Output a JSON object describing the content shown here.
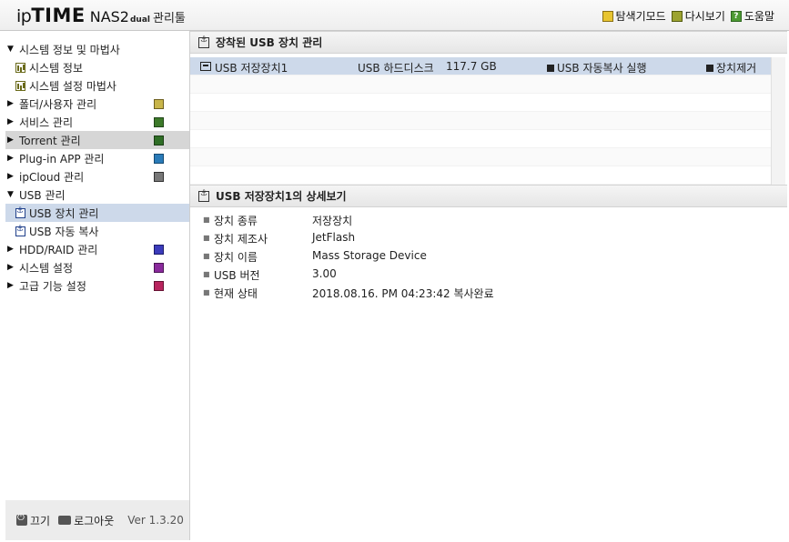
{
  "header": {
    "logo_ip": "ip",
    "logo_time": "TIME",
    "logo_model": "NAS2",
    "logo_suffix": "dual",
    "logo_tool": "관리툴",
    "links": [
      {
        "label": "탐색기모드",
        "icon": "explorer-mode-icon"
      },
      {
        "label": "다시보기",
        "icon": "refresh-icon"
      },
      {
        "label": "도움말",
        "icon": "help-icon"
      }
    ]
  },
  "sidebar": {
    "items": [
      {
        "label": "시스템 정보 및 마법사",
        "arrow": "▼"
      },
      {
        "label": "시스템 정보"
      },
      {
        "label": "시스템 설정 마법사"
      },
      {
        "label": "폴더/사용자 관리",
        "arrow": "▶"
      },
      {
        "label": "서비스 관리",
        "arrow": "▶"
      },
      {
        "label": "Torrent 관리",
        "arrow": "▶"
      },
      {
        "label": "Plug-in APP 관리",
        "arrow": "▶"
      },
      {
        "label": "ipCloud 관리",
        "arrow": "▶"
      },
      {
        "label": "USB 관리",
        "arrow": "▼"
      },
      {
        "label": "USB 장치 관리"
      },
      {
        "label": "USB 자동 복사"
      },
      {
        "label": "HDD/RAID 관리",
        "arrow": "▶"
      },
      {
        "label": "시스템 설정",
        "arrow": "▶"
      },
      {
        "label": "고급 기능 설정",
        "arrow": "▶"
      }
    ],
    "footer": {
      "power_label": "끄기",
      "logout_label": "로그아웃",
      "version": "Ver 1.3.20"
    }
  },
  "devices_panel": {
    "title": "장착된 USB 장치 관리",
    "rows": [
      {
        "name": "USB 저장장치1",
        "type": "USB 하드디스크",
        "size": "117.7 GB",
        "autocopy_label": "USB 자동복사 실행",
        "remove_label": "장치제거"
      }
    ]
  },
  "detail_panel": {
    "title": "USB 저장장치1의 상세보기",
    "fields": [
      {
        "label": "장치 종류",
        "value": "저장장치"
      },
      {
        "label": "장치 제조사",
        "value": "JetFlash"
      },
      {
        "label": "장치 이름",
        "value": "Mass Storage Device"
      },
      {
        "label": "USB 버전",
        "value": "3.00"
      },
      {
        "label": "현재 상태",
        "value": "2018.08.16. PM 04:23:42 복사완료"
      }
    ]
  }
}
